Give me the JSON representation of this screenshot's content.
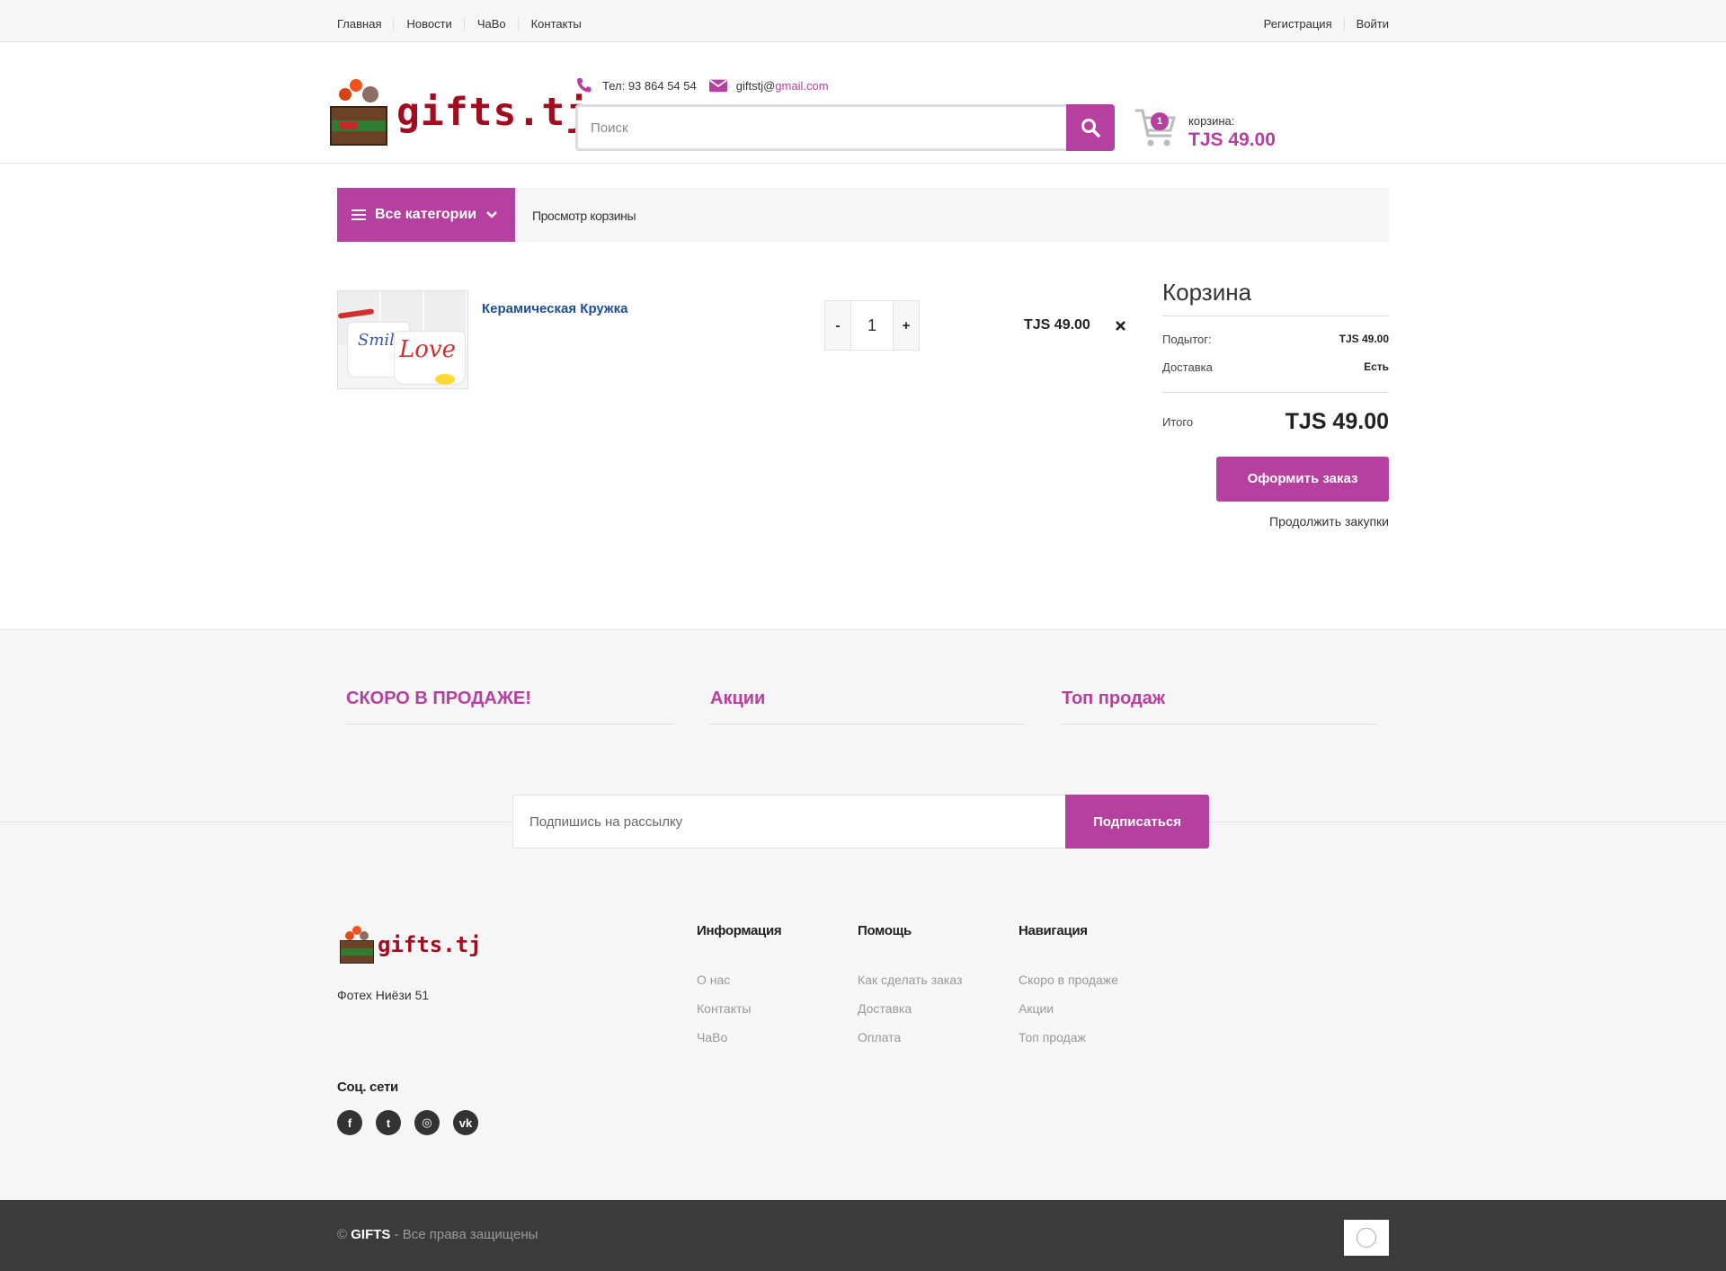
{
  "topbar": {
    "nav": [
      "Главная",
      "Новости",
      "ЧаВо",
      "Контакты"
    ],
    "register": "Регистрация",
    "login": "Войти"
  },
  "header": {
    "logo_text": "gifts.tj",
    "phone": "Тел: 93 864 54 54",
    "email_user": "giftstj@",
    "email_domain": "gmail.com",
    "search_placeholder": "Поиск",
    "cart_label": "корзина:",
    "cart_amount": "TJS 49.00",
    "cart_count": "1"
  },
  "catbar": {
    "all_categories": "Все категории",
    "breadcrumb": "Просмотр корзины"
  },
  "cart": {
    "item": {
      "name": "Керамическая Кружка",
      "image_icon": "mug-image",
      "image_text_1": "Smil",
      "image_text_2": "Love",
      "qty": "1",
      "minus": "-",
      "plus": "+",
      "price": "TJS 49.00"
    }
  },
  "summary": {
    "title": "Корзина",
    "subtotal_label": "Подытог:",
    "subtotal_value": "TJS 49.00",
    "shipping_label": "Доставка",
    "shipping_value": "Есть",
    "total_label": "Итого",
    "total_value": "TJS 49.00",
    "checkout": "Оформить заказ",
    "continue": "Продолжить закупки"
  },
  "promo": [
    "СКОРО В ПРОДАЖЕ!",
    "Акции",
    "Топ продаж"
  ],
  "newsletter": {
    "placeholder": "Подпишись на рассылку",
    "button": "Подписаться"
  },
  "footer": {
    "logo_text": "gifts.tj",
    "address": "Фотех Ниёзи 51",
    "columns": [
      {
        "title": "Информация",
        "links": [
          "О нас",
          "Контакты",
          "ЧаВо"
        ]
      },
      {
        "title": "Помощь",
        "links": [
          "Как сделать заказ",
          "Доставка",
          "Оплата"
        ]
      },
      {
        "title": "Навигация",
        "links": [
          "Скоро в продаже",
          "Акции",
          "Топ продаж"
        ]
      }
    ],
    "social_title": "Соц. сети",
    "social": [
      "facebook-icon",
      "twitter-icon",
      "dribbble-icon",
      "vk-icon"
    ],
    "social_glyphs": [
      "f",
      "t",
      "◎",
      "vk"
    ]
  },
  "bottombar": {
    "copyright_prefix": "© ",
    "brand": "GIFTS",
    "rights": " - Все права защищены"
  },
  "colors": {
    "accent": "#b6409f",
    "link_blue": "#1e4f97",
    "logo_red": "#a30b1f",
    "footer_dark": "#3b3b3b"
  }
}
